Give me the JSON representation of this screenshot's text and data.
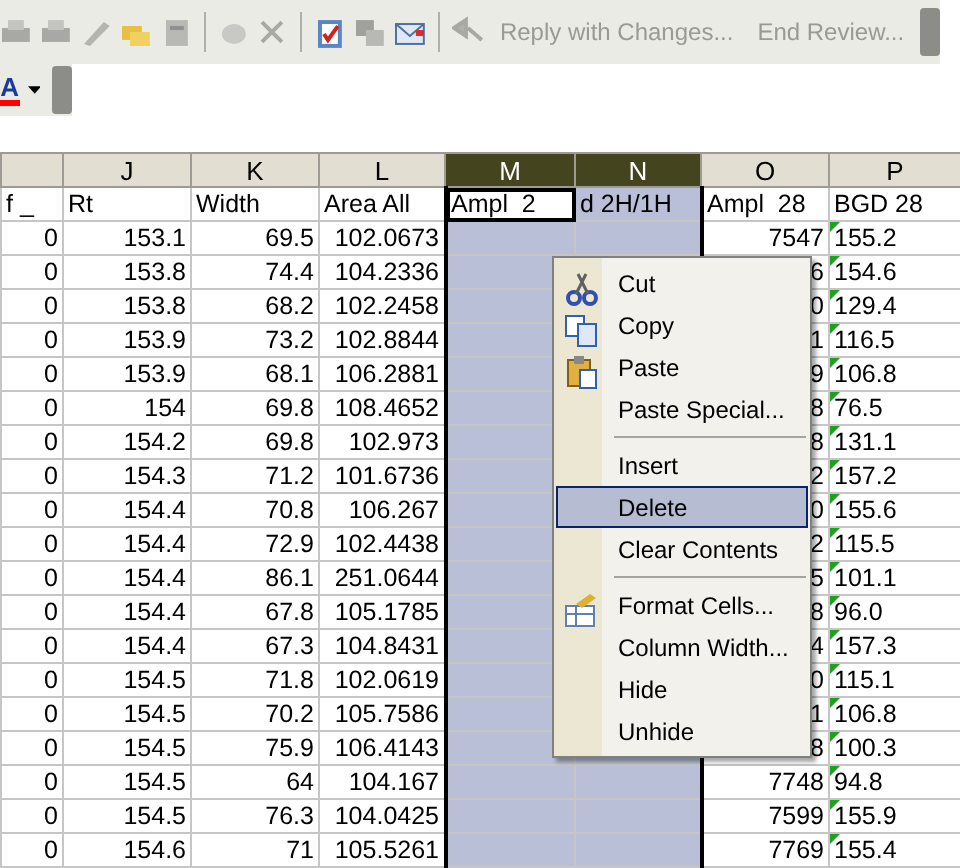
{
  "toolbar": {
    "review_buttons": [
      {
        "label": "Reply with Changes...",
        "disabled": true
      },
      {
        "label": "End Review...",
        "disabled": true
      }
    ],
    "font_color": {
      "label": "A"
    }
  },
  "table": {
    "columns": [
      {
        "label": "f _",
        "selected": false,
        "active": false
      },
      {
        "letter": "J",
        "label": "Rt",
        "selected": false,
        "active": false
      },
      {
        "letter": "K",
        "label": "Width",
        "selected": false,
        "active": false
      },
      {
        "letter": "L",
        "label": "Area All",
        "selected": false,
        "active": false
      },
      {
        "letter": "M",
        "label": "Ampl  2",
        "selected": true,
        "active": true
      },
      {
        "letter": "N",
        "label": "d 2H/1H",
        "selected": true,
        "active": false
      },
      {
        "letter": "O",
        "label": "Ampl  28",
        "selected": false,
        "active": false
      },
      {
        "letter": "P",
        "label": "BGD 28",
        "selected": false,
        "active": false,
        "flagged": true
      }
    ],
    "rows": [
      [
        "0",
        "153.1",
        "69.5",
        "102.0673",
        null,
        null,
        "7547",
        "155.2"
      ],
      [
        "0",
        "153.8",
        "74.4",
        "104.2336",
        null,
        null,
        "6",
        "154.6"
      ],
      [
        "0",
        "153.8",
        "68.2",
        "102.2458",
        null,
        null,
        "0",
        "129.4"
      ],
      [
        "0",
        "153.9",
        "73.2",
        "102.8844",
        null,
        null,
        "1",
        "116.5"
      ],
      [
        "0",
        "153.9",
        "68.1",
        "106.2881",
        null,
        null,
        "9",
        "106.8"
      ],
      [
        "0",
        "154",
        "69.8",
        "108.4652",
        null,
        null,
        "8",
        "76.5"
      ],
      [
        "0",
        "154.2",
        "69.8",
        "102.973",
        null,
        null,
        "8",
        "131.1"
      ],
      [
        "0",
        "154.3",
        "71.2",
        "101.6736",
        null,
        null,
        "2",
        "157.2"
      ],
      [
        "0",
        "154.4",
        "70.8",
        "106.267",
        null,
        null,
        "0",
        "155.6"
      ],
      [
        "0",
        "154.4",
        "72.9",
        "102.4438",
        null,
        null,
        "2",
        "115.5"
      ],
      [
        "0",
        "154.4",
        "86.1",
        "251.0644",
        null,
        null,
        "5",
        "101.1"
      ],
      [
        "0",
        "154.4",
        "67.8",
        "105.1785",
        null,
        null,
        "8",
        "96.0"
      ],
      [
        "0",
        "154.4",
        "67.3",
        "104.8431",
        null,
        null,
        "4",
        "157.3"
      ],
      [
        "0",
        "154.5",
        "71.8",
        "102.0619",
        null,
        null,
        "0",
        "115.1"
      ],
      [
        "0",
        "154.5",
        "70.2",
        "105.7586",
        null,
        null,
        "1",
        "106.8"
      ],
      [
        "0",
        "154.5",
        "75.9",
        "106.4143",
        null,
        null,
        "8",
        "100.3"
      ],
      [
        "0",
        "154.5",
        "64",
        "104.167",
        null,
        null,
        "7748",
        "94.8"
      ],
      [
        "0",
        "154.5",
        "76.3",
        "104.0425",
        null,
        null,
        "7599",
        "155.9"
      ],
      [
        "0",
        "154.6",
        "71",
        "105.5261",
        null,
        null,
        "7769",
        "155.4"
      ]
    ]
  },
  "context_menu": {
    "items": [
      {
        "kind": "item",
        "label": "Cut",
        "selected": false
      },
      {
        "kind": "item",
        "label": "Copy",
        "selected": false
      },
      {
        "kind": "item",
        "label": "Paste",
        "selected": false
      },
      {
        "kind": "item",
        "label": "Paste Special...",
        "selected": false
      },
      {
        "kind": "separator"
      },
      {
        "kind": "item",
        "label": "Insert",
        "selected": false
      },
      {
        "kind": "item",
        "label": "Delete",
        "selected": true
      },
      {
        "kind": "item",
        "label": "Clear Contents",
        "selected": false
      },
      {
        "kind": "separator"
      },
      {
        "kind": "item",
        "label": "Format Cells...",
        "selected": false
      },
      {
        "kind": "item",
        "label": "Column Width...",
        "selected": false
      },
      {
        "kind": "item",
        "label": "Hide",
        "selected": false
      },
      {
        "kind": "item",
        "label": "Unhide",
        "selected": false
      }
    ]
  }
}
